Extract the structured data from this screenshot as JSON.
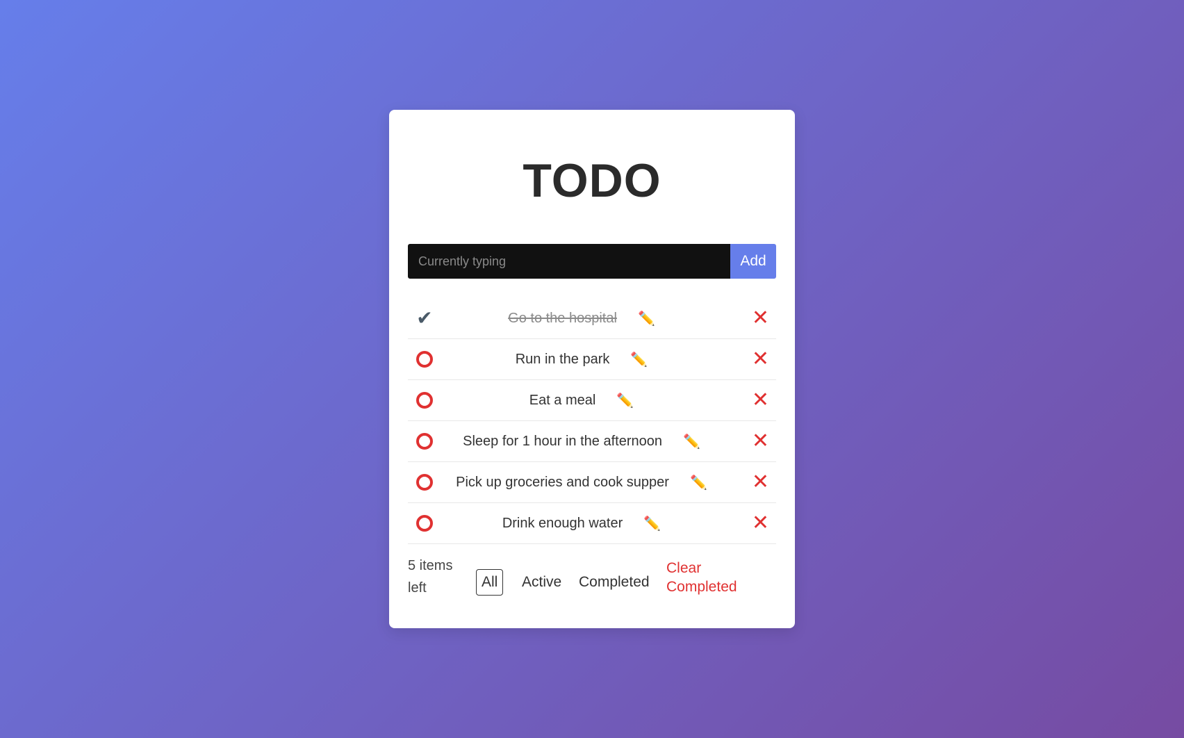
{
  "app": {
    "title": "TODO"
  },
  "input": {
    "placeholder": "Currently typing",
    "value": "",
    "add_label": "Add"
  },
  "todos": [
    {
      "text": "Go to the hospital",
      "completed": true
    },
    {
      "text": "Run in the park",
      "completed": false
    },
    {
      "text": "Eat a meal",
      "completed": false
    },
    {
      "text": "Sleep for 1 hour in the afternoon",
      "completed": false
    },
    {
      "text": "Pick up groceries and cook supper",
      "completed": false
    },
    {
      "text": "Drink enough water",
      "completed": false
    }
  ],
  "icons": {
    "completed": "check-icon",
    "active": "circle-icon",
    "edit": "pencil-icon",
    "delete": "close-icon"
  },
  "footer": {
    "items_left_line1": "5 items",
    "items_left_line2": "left",
    "filters": {
      "all": "All",
      "active": "Active",
      "completed": "Completed"
    },
    "selected_filter": "All",
    "clear_line1": "Clear",
    "clear_line2": "Completed"
  },
  "colors": {
    "background_start": "#667eea",
    "background_end": "#764ba2",
    "accent": "#667eea",
    "danger": "#e03131",
    "input_bg": "#111111"
  }
}
